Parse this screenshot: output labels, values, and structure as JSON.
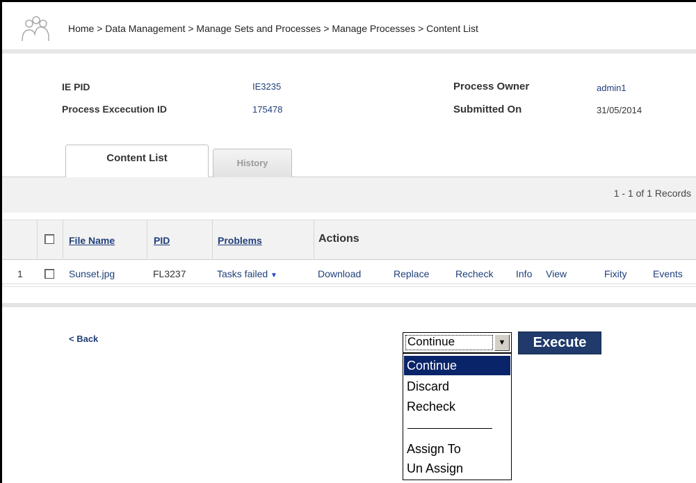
{
  "header": {
    "breadcrumb": "Home > Data Management > Manage Sets and Processes > Manage Processes > Content List"
  },
  "info": {
    "ie_pid_label": "IE PID",
    "ie_pid_value": "IE3235",
    "exec_id_label": "Process Excecution ID",
    "exec_id_value": "175478",
    "owner_label": "Process Owner",
    "owner_value": "admin1",
    "submitted_label": "Submitted On",
    "submitted_value": "31/05/2014"
  },
  "tabs": [
    {
      "label": "Content List",
      "active": true
    },
    {
      "label": "History",
      "active": false
    }
  ],
  "records": "1 - 1 of 1 Records",
  "table": {
    "headers": {
      "file_name": "File Name",
      "pid": "PID",
      "problems": "Problems",
      "actions": "Actions"
    },
    "rows": [
      {
        "index": "1",
        "file_name": "Sunset.jpg",
        "pid": "FL3237",
        "problems": "Tasks failed",
        "actions": [
          "Download",
          "Replace",
          "Recheck",
          "Info",
          "View",
          "Fixity",
          "Events"
        ]
      }
    ]
  },
  "footer": {
    "back_label": "< Back",
    "select_value": "Continue",
    "execute_label": "Execute",
    "options": [
      "Continue",
      "Discard",
      "Recheck",
      "Assign To",
      "Un Assign"
    ]
  },
  "colors": {
    "link": "#1f3f7a",
    "button": "#1f3a6b",
    "selected_option": "#0a246a"
  }
}
